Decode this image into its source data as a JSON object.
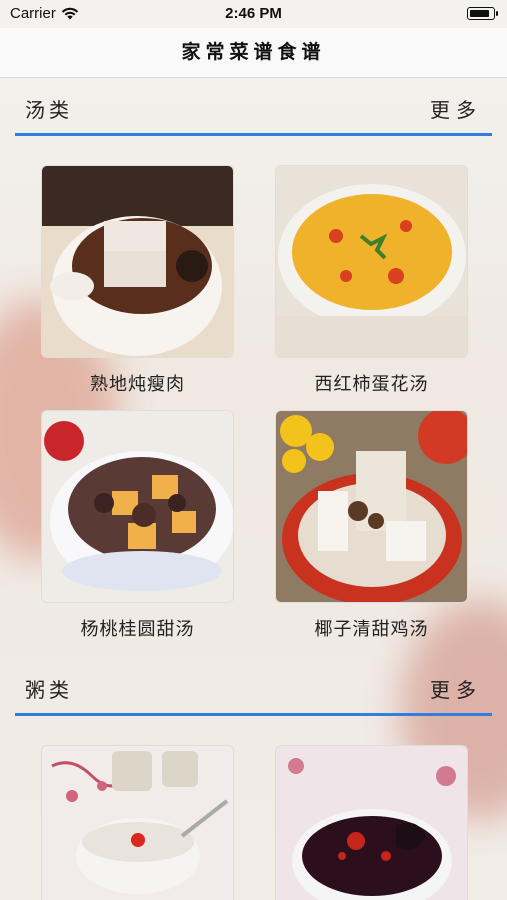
{
  "status_bar": {
    "carrier": "Carrier",
    "time": "2:46 PM",
    "battery_level": 0.9
  },
  "nav": {
    "title": "家常菜谱食谱"
  },
  "sections": [
    {
      "title": "汤类",
      "more": "更多",
      "items": [
        {
          "name": "熟地炖瘦肉"
        },
        {
          "name": "西红柿蛋花汤"
        },
        {
          "name": "杨桃桂圆甜汤"
        },
        {
          "name": "椰子清甜鸡汤"
        }
      ]
    },
    {
      "title": "粥类",
      "more": "更多",
      "items": [
        {
          "name": ""
        },
        {
          "name": ""
        }
      ]
    }
  ],
  "colors": {
    "accent": "#2f7fe0"
  }
}
